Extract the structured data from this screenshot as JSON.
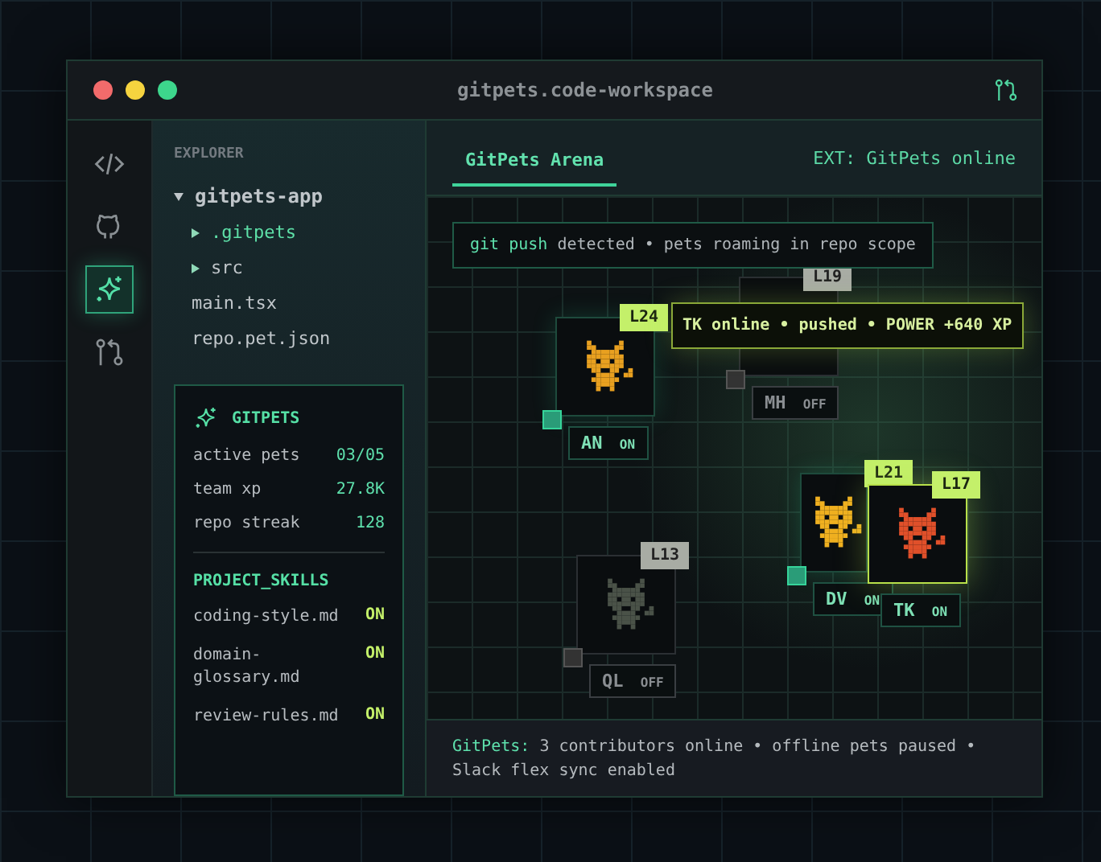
{
  "window": {
    "title": "gitpets.code-workspace"
  },
  "activity_bar": [
    {
      "kind": "code",
      "selected": false
    },
    {
      "kind": "github",
      "selected": false
    },
    {
      "kind": "sparkle",
      "selected": true
    },
    {
      "kind": "branch",
      "selected": false
    }
  ],
  "explorer": {
    "title": "EXPLORER",
    "tree": [
      {
        "label": "gitpets-app",
        "kind": "folder",
        "expanded": true,
        "selected": false,
        "children": [
          {
            "label": ".gitpets",
            "kind": "folder",
            "expanded": false,
            "selected": true
          },
          {
            "label": "src",
            "kind": "folder",
            "expanded": false,
            "selected": false
          },
          {
            "label": "main.tsx",
            "kind": "file",
            "selected": false
          },
          {
            "label": "repo.pet.json",
            "kind": "file",
            "selected": false
          }
        ]
      }
    ]
  },
  "panel": {
    "title": "GITPETS",
    "stats": [
      {
        "label": "active pets",
        "value": "03/05"
      },
      {
        "label": "team xp",
        "value": "27.8K"
      },
      {
        "label": "repo streak",
        "value": "128"
      }
    ],
    "skills_title": "PROJECT_SKILLS",
    "skills": [
      {
        "name": "coding-style.md",
        "status": "ON",
        "on": true
      },
      {
        "name": "domain-glossary.md",
        "status": "ON",
        "on": true
      },
      {
        "name": "review-rules.md",
        "status": "ON",
        "on": true
      }
    ]
  },
  "tabs": [
    {
      "label": "GitPets Arena",
      "selected": true
    }
  ],
  "extension_status": "EXT: GitPets online",
  "arena": {
    "notice": {
      "command": "git push",
      "text": "detected • pets roaming in repo scope"
    },
    "tooltip": "TK online • pushed • POWER +640 XP",
    "pets": [
      {
        "initials": "AN",
        "status": "ON",
        "online": true,
        "selected": false,
        "badge": "L24",
        "color": "#e8a020"
      },
      {
        "initials": "MH",
        "status": "OFF",
        "online": false,
        "selected": false,
        "badge": "L19"
      },
      {
        "initials": "DV",
        "status": "ON",
        "online": true,
        "selected": false,
        "badge": "L21",
        "color": "#f0b020"
      },
      {
        "initials": "TK",
        "status": "ON",
        "online": true,
        "selected": true,
        "badge": "L17",
        "color": "#e0502a"
      },
      {
        "initials": "QL",
        "status": "OFF",
        "online": false,
        "selected": false,
        "badge": "L13",
        "color": "#4a5248"
      }
    ]
  },
  "status_bar": {
    "source": "GitPets:",
    "message": "3 contributors online • offline pets paused • Slack flex sync enabled"
  }
}
